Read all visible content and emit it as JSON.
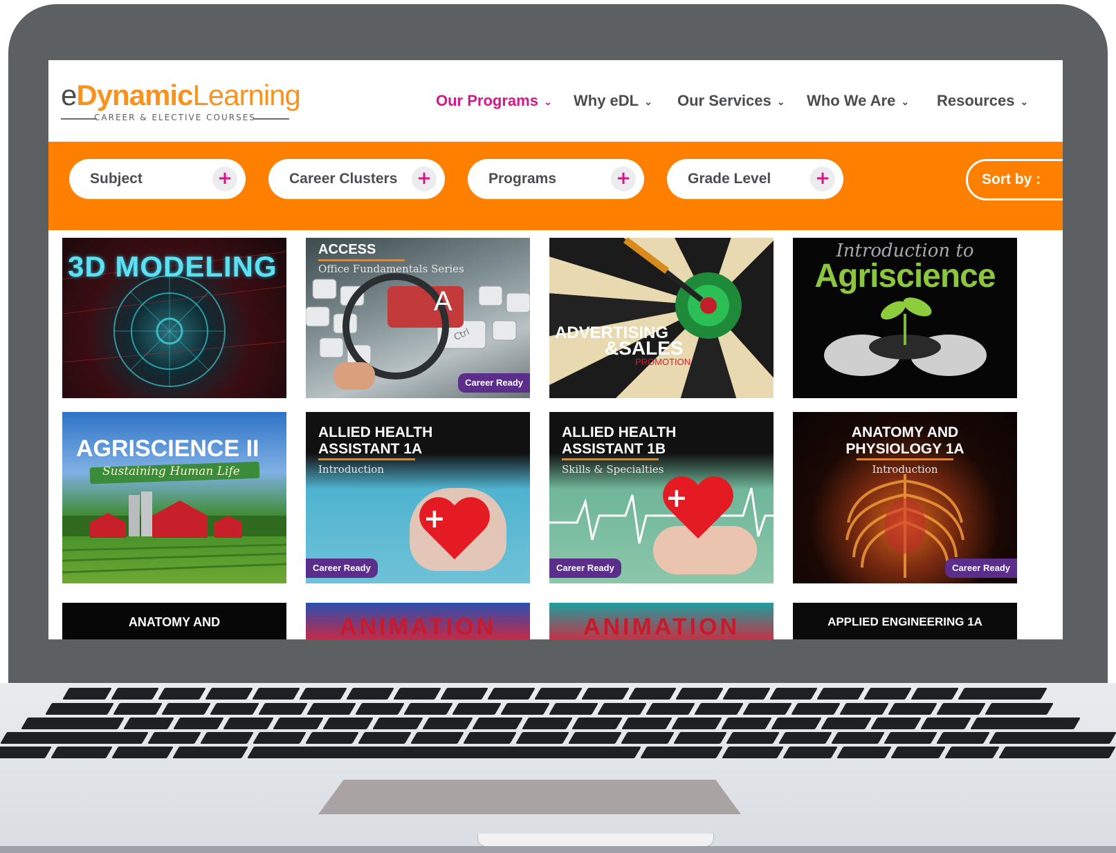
{
  "logo": {
    "e": "e",
    "dynamic": "Dynamic",
    "learning": "Learning",
    "tagline": "CAREER & ELECTIVE COURSES"
  },
  "nav": [
    {
      "label": "Our Programs",
      "active": true
    },
    {
      "label": "Why eDL"
    },
    {
      "label": "Our Services"
    },
    {
      "label": "Who We Are"
    },
    {
      "label": "Resources"
    }
  ],
  "filters": [
    {
      "label": "Subject"
    },
    {
      "label": "Career Clusters"
    },
    {
      "label": "Programs"
    },
    {
      "label": "Grade Level"
    }
  ],
  "sort": {
    "label": "Sort by :"
  },
  "courses": [
    {
      "title": "3D MODELING"
    },
    {
      "title": "ACCESS",
      "subtitle": "Office Fundamentals Series",
      "key_letter": "A",
      "key_ctrl": "Ctrl",
      "badge": "Career Ready"
    },
    {
      "title_line1": "ADVERTISING",
      "title_line2": "&SALES",
      "title_line3": "PROMOTION"
    },
    {
      "title_line1": "Introduction to",
      "title_line2": "Agriscience"
    },
    {
      "title": "AGRISCIENCE II",
      "subtitle": "Sustaining Human Life"
    },
    {
      "title_line1": "ALLIED HEALTH",
      "title_line2": "ASSISTANT 1A",
      "subtitle": "Introduction",
      "badge": "Career Ready"
    },
    {
      "title_line1": "ALLIED HEALTH",
      "title_line2": "ASSISTANT 1B",
      "subtitle": "Skills & Specialties",
      "badge": "Career Ready"
    },
    {
      "title_line1": "ANATOMY AND",
      "title_line2": "PHYSIOLOGY 1A",
      "subtitle": "Introduction",
      "badge": "Career Ready"
    },
    {
      "title": "ANATOMY AND"
    },
    {
      "title": "ANIMATION"
    },
    {
      "title": "ANIMATION"
    },
    {
      "title": "APPLIED ENGINEERING 1A"
    }
  ],
  "colors": {
    "orange": "#ff7f00",
    "magenta": "#d6168a",
    "purple": "#5a2e8a",
    "logo_orange": "#f7931e"
  }
}
